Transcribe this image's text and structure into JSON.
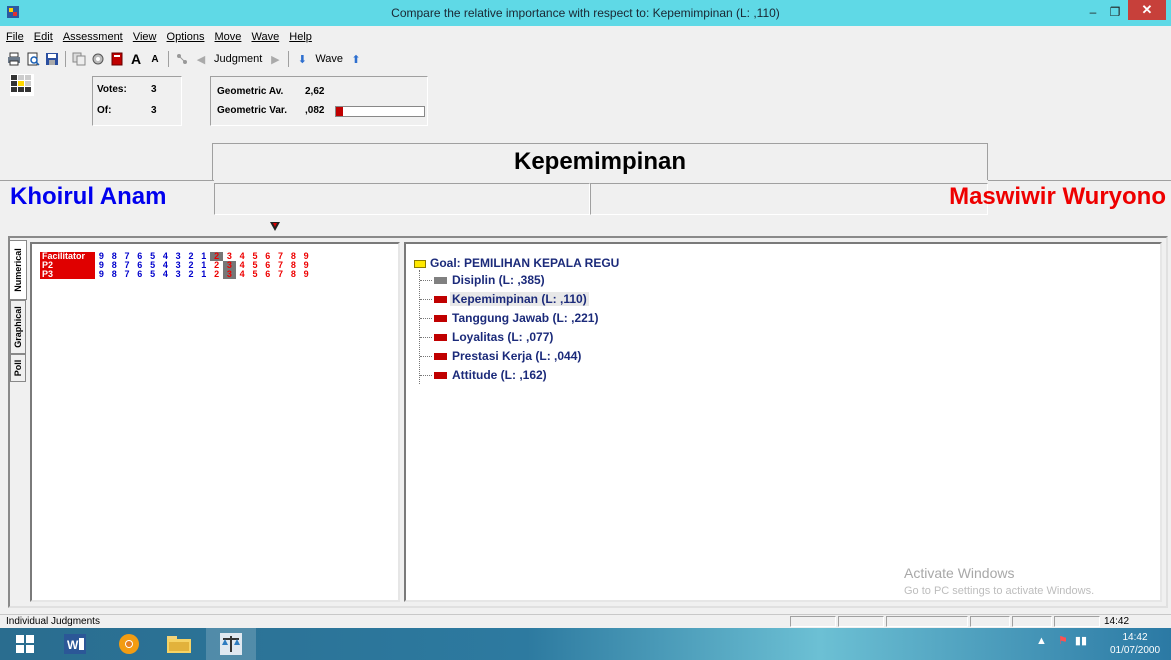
{
  "window": {
    "title": "Compare the relative importance  with respect to: Kepemimpinan (L: ,110)",
    "minimize": "–",
    "maximize": "❐",
    "close": "✕"
  },
  "menu": [
    "File",
    "Edit",
    "Assessment",
    "View",
    "Options",
    "Move",
    "Wave",
    "Help"
  ],
  "toolbar": {
    "judgment_label": "Judgment",
    "wave_label": "Wave"
  },
  "votes": {
    "votes_label": "Votes:",
    "votes_value": "3",
    "of_label": "Of:",
    "of_value": "3"
  },
  "geometric": {
    "av_label": "Geometric Av.",
    "av_value": "2,62",
    "var_label": "Geometric Var.",
    "var_value": ",082",
    "var_fraction": 0.082
  },
  "comparison": {
    "criterion": "Kepemimpinan",
    "left": "Khoirul Anam",
    "right": "Maswiwir Wuryono"
  },
  "side_tabs": [
    "Numerical",
    "Graphical",
    "Poll"
  ],
  "judgments": {
    "scale_left": [
      "9",
      "8",
      "7",
      "6",
      "5",
      "4",
      "3",
      "2",
      "1"
    ],
    "scale_right": [
      "2",
      "3",
      "4",
      "5",
      "6",
      "7",
      "8",
      "9"
    ],
    "rows": [
      {
        "name": "Facilitator",
        "selected": "left-of-1-2"
      },
      {
        "name": "P2",
        "selected": "3"
      },
      {
        "name": "P3",
        "selected": "3"
      }
    ]
  },
  "tree": {
    "goal": "Goal: PEMILIHAN KEPALA REGU",
    "nodes": [
      {
        "label": "Disiplin (L: ,385)",
        "color": "#808080"
      },
      {
        "label": "Kepemimpinan (L: ,110)",
        "color": "#c00000"
      },
      {
        "label": "Tanggung Jawab (L: ,221)",
        "color": "#c00000"
      },
      {
        "label": "Loyalitas (L: ,077)",
        "color": "#c00000"
      },
      {
        "label": "Prestasi Kerja (L: ,044)",
        "color": "#c00000"
      },
      {
        "label": "Attitude (L: ,162)",
        "color": "#c00000"
      }
    ]
  },
  "watermark": {
    "line1": "Activate Windows",
    "line2": "Go to PC settings to activate Windows."
  },
  "status": {
    "text": "Individual Judgments",
    "time": "14:42"
  },
  "taskbar": {
    "clock_time": "14:42",
    "clock_date": "01/07/2000"
  }
}
